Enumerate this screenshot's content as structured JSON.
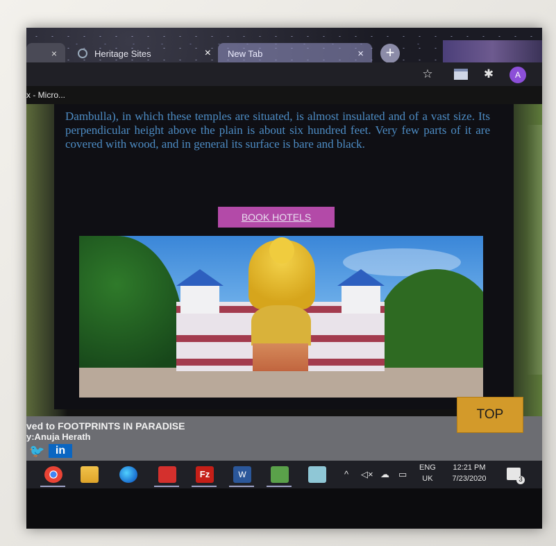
{
  "browser": {
    "tabs": [
      {
        "label": "",
        "close": "×"
      },
      {
        "label": "Heritage Sites",
        "close": "×"
      },
      {
        "label": "New Tab",
        "close": "×"
      }
    ],
    "new_tab": "+",
    "avatar_initial": "A",
    "bookmark_label": "x - Micro..."
  },
  "article": {
    "text": "Dambulla), in which these temples are situated, is almost insulated and of a vast size. Its perpendicular height above the plain is about six hundred feet. Very few parts of it are covered with wood, and in general its surface is bare and black."
  },
  "book_button": {
    "label": "BOOK HOTELS",
    "color": "#b34aa8"
  },
  "top_button": {
    "label": "TOP",
    "color": "#d39a2a"
  },
  "footer": {
    "copyright": "ved to FOOTPRINTS IN PARADISE",
    "author": "y:Anuja Herath",
    "social": {
      "twitter_icon": "twitter-icon",
      "linkedin_label": "in"
    }
  },
  "taskbar": {
    "apps": [
      "chrome-icon",
      "folder-icon",
      "edge-icon",
      "app-icon",
      "filezilla-icon",
      "word-icon",
      "notepad-icon",
      "app-icon"
    ],
    "filezilla_label": "Fz",
    "word_label": "W",
    "language": {
      "line1": "ENG",
      "line2": "UK"
    },
    "time": "12:21 PM",
    "date": "7/23/2020",
    "notifications": "3"
  }
}
